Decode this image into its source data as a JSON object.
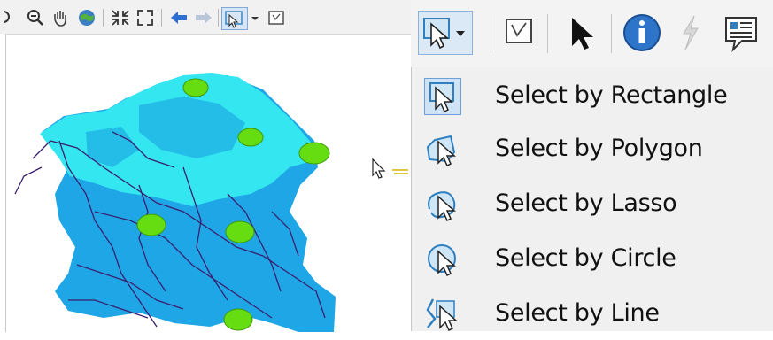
{
  "dropdown": {
    "items": [
      {
        "label": "Select by Rectangle",
        "icon": "select-rectangle-icon",
        "selected": true
      },
      {
        "label": "Select by Polygon",
        "icon": "select-polygon-icon",
        "selected": false
      },
      {
        "label": "Select by Lasso",
        "icon": "select-lasso-icon",
        "selected": false
      },
      {
        "label": "Select by Circle",
        "icon": "select-circle-icon",
        "selected": false
      },
      {
        "label": "Select by Line",
        "icon": "select-line-icon",
        "selected": false
      }
    ]
  },
  "big_toolbar": {
    "buttons": [
      "select-features-icon",
      "clear-selection-icon",
      "select-elements-icon",
      "identify-icon",
      "hyperlink-icon",
      "html-popup-icon"
    ]
  },
  "small_toolbar": {
    "buttons": [
      "zoom-out-icon",
      "pan-icon",
      "full-extent-icon",
      "fixed-zoom-in-icon",
      "fixed-zoom-out-icon",
      "back-icon",
      "forward-icon",
      "select-features-icon",
      "clear-selection-icon"
    ]
  },
  "colors": {
    "selected_area": "#33e6f0",
    "base_area": "#1fa6e6",
    "rivers": "#3a1f6e",
    "points": "#66dd11"
  }
}
